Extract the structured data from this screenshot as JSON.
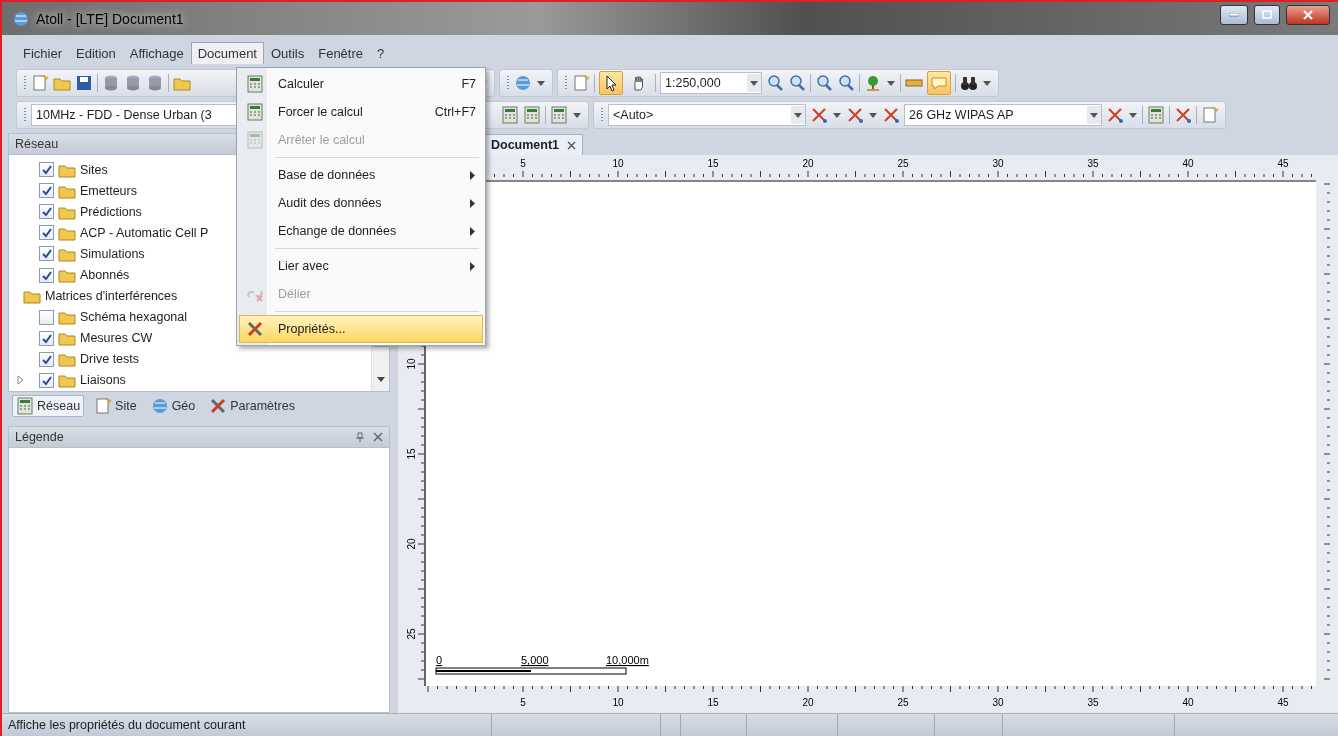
{
  "window": {
    "title": "Atoll - [LTE] Document1"
  },
  "menu_bar": [
    {
      "label": "Fichier",
      "selected": false
    },
    {
      "label": "Edition",
      "selected": false
    },
    {
      "label": "Affichage",
      "selected": false
    },
    {
      "label": "Document",
      "selected": true
    },
    {
      "label": "Outils",
      "selected": false
    },
    {
      "label": "Fenêtre",
      "selected": false
    },
    {
      "label": "?",
      "selected": false
    }
  ],
  "open_menu": {
    "items": [
      {
        "kind": "command",
        "label": "Calculer",
        "shortcut": "F7",
        "disabled": false,
        "selected": false
      },
      {
        "kind": "command",
        "label": "Forcer le calcul",
        "shortcut": "Ctrl+F7",
        "disabled": false,
        "selected": false
      },
      {
        "kind": "command",
        "label": "Arrêter le calcul",
        "disabled": true,
        "selected": false
      },
      {
        "kind": "separator"
      },
      {
        "kind": "submenu",
        "label": "Base de données",
        "disabled": false,
        "selected": false
      },
      {
        "kind": "submenu",
        "label": "Audit des données",
        "disabled": false,
        "selected": false
      },
      {
        "kind": "submenu",
        "label": "Echange de données",
        "disabled": false,
        "selected": false
      },
      {
        "kind": "separator"
      },
      {
        "kind": "submenu",
        "label": "Lier avec",
        "disabled": false,
        "selected": false
      },
      {
        "kind": "command",
        "label": "Délier",
        "disabled": true,
        "selected": false
      },
      {
        "kind": "separator"
      },
      {
        "kind": "command",
        "label": "Propriétés...",
        "disabled": false,
        "selected": true
      }
    ]
  },
  "toolbar": {
    "scale": "1:250,000",
    "tools": [
      {
        "kind": "pointer",
        "selected": true
      },
      {
        "kind": "hand",
        "selected": false
      }
    ],
    "tooltips": {
      "selected": true
    }
  },
  "toolbar_2": {
    "configuration": "10MHz - FDD - Dense Urban (3",
    "zone": "<Auto>",
    "equipment": "26 GHz WIPAS AP"
  },
  "network_panel": {
    "title": "Réseau",
    "items": [
      {
        "kind": "check",
        "label": "Sites",
        "checked": true
      },
      {
        "kind": "check",
        "label": "Emetteurs",
        "checked": true
      },
      {
        "kind": "check",
        "label": "Prédictions",
        "checked": true
      },
      {
        "kind": "check",
        "label": "ACP - Automatic Cell P",
        "checked": true
      },
      {
        "kind": "check",
        "label": "Simulations",
        "checked": true
      },
      {
        "kind": "check",
        "label": "Abonnés",
        "checked": true
      },
      {
        "kind": "plain",
        "label": "Matrices d'interférences"
      },
      {
        "kind": "check",
        "label": "Schéma hexagonal",
        "checked": false
      },
      {
        "kind": "check",
        "label": "Mesures CW",
        "checked": true
      },
      {
        "kind": "check",
        "label": "Drive tests",
        "checked": true
      },
      {
        "kind": "expandable",
        "label": "Liaisons",
        "checked": true,
        "expanded": false
      }
    ],
    "tabs": [
      {
        "label": "Réseau",
        "selected": true
      },
      {
        "label": "Site",
        "selected": false
      },
      {
        "label": "Géo",
        "selected": false
      },
      {
        "label": "Paramètres",
        "selected": false
      }
    ]
  },
  "legend_panel": {
    "title": "Légende"
  },
  "document_tab": {
    "title": "Document1"
  },
  "top_ruler": {
    "labels": [
      "5",
      "10",
      "15",
      "20",
      "25",
      "30",
      "35",
      "40",
      "45"
    ]
  },
  "left_ruler": {
    "labels": [
      "10",
      "15",
      "20",
      "25"
    ]
  },
  "bottom_ruler": {
    "labels": [
      "5",
      "10",
      "15",
      "20",
      "25",
      "30",
      "35",
      "40",
      "45"
    ]
  },
  "scale_bar": {
    "labels": [
      "0",
      "5,000",
      "10,000m"
    ]
  },
  "status_bar": {
    "message": "Affiche les propriétés du document courant"
  }
}
